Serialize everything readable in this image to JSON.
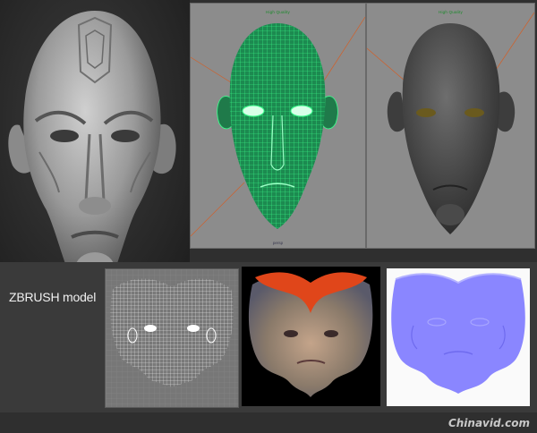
{
  "panels": {
    "sculpt": {
      "name": "zbrush-sculpt-render"
    },
    "wireframe_viewport": {
      "caption": "High Quality",
      "footer": "persp"
    },
    "shaded_viewport": {
      "caption": "High Quality"
    }
  },
  "labels": {
    "zbrush_model": "ZBRUSH model"
  },
  "maps": {
    "uv_wire": "uv-wireframe-map",
    "color": "color-texture-map",
    "normal": "normal-map"
  },
  "watermark": "Chinavid.com",
  "colors": {
    "wire_green": "#3cff8c",
    "normal_blue": "#8a86ff",
    "viewport_gray": "#8c8c8c",
    "texture_orange": "#e0461a"
  }
}
